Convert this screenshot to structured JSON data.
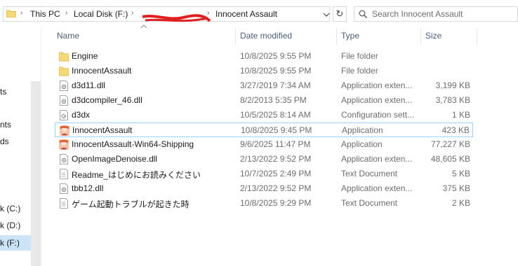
{
  "address_bar": {
    "crumbs": [
      "This PC",
      "Local Disk (F:)",
      "Innocent Assault"
    ]
  },
  "search": {
    "placeholder": "Search Innocent Assault"
  },
  "nav_pane": {
    "items": [
      "ts",
      "nts",
      "ds",
      "k (C:)",
      "k (D:)",
      "k (F:)"
    ]
  },
  "columns": {
    "name": "Name",
    "date": "Date modified",
    "type": "Type",
    "size": "Size"
  },
  "files": [
    {
      "name": "Engine",
      "date": "10/8/2025 9:55 PM",
      "type": "File folder",
      "size": "",
      "icon": "folder-icon"
    },
    {
      "name": "InnocentAssault",
      "date": "10/8/2025 9:55 PM",
      "type": "File folder",
      "size": "",
      "icon": "folder-icon"
    },
    {
      "name": "d3d11.dll",
      "date": "3/27/2019 7:34 AM",
      "type": "Application exten...",
      "size": "3,199 KB",
      "icon": "dll-file-icon"
    },
    {
      "name": "d3dcompiler_46.dll",
      "date": "8/2/2013 5:35 PM",
      "type": "Application exten...",
      "size": "3,783 KB",
      "icon": "dll-file-icon"
    },
    {
      "name": "d3dx",
      "date": "10/5/2025 8:14 AM",
      "type": "Configuration sett...",
      "size": "1 KB",
      "icon": "config-file-icon"
    },
    {
      "name": "InnocentAssault",
      "date": "10/8/2025 9:45 PM",
      "type": "Application",
      "size": "423 KB",
      "icon": "game-app-icon"
    },
    {
      "name": "InnocentAssault-Win64-Shipping",
      "date": "9/6/2025 11:47 PM",
      "type": "Application",
      "size": "77,227 KB",
      "icon": "game-app-icon"
    },
    {
      "name": "OpenImageDenoise.dll",
      "date": "2/13/2022 9:52 PM",
      "type": "Application exten...",
      "size": "48,605 KB",
      "icon": "dll-file-icon"
    },
    {
      "name": "Readme_はじめにお読みください",
      "date": "10/7/2025 2:49 PM",
      "type": "Text Document",
      "size": "5 KB",
      "icon": "text-file-icon"
    },
    {
      "name": "tbb12.dll",
      "date": "2/13/2022 9:52 PM",
      "type": "Application exten...",
      "size": "375 KB",
      "icon": "dll-file-icon"
    },
    {
      "name": "ゲーム起動トラブルが起きた時",
      "date": "10/8/2025 9:29 PM",
      "type": "Text Document",
      "size": "2 KB",
      "icon": "text-file-icon"
    }
  ],
  "colors": {
    "selection": "#cce4f7",
    "focus_border": "#99d1ff",
    "header_text": "#4c607a",
    "folder": "#f8d775"
  }
}
